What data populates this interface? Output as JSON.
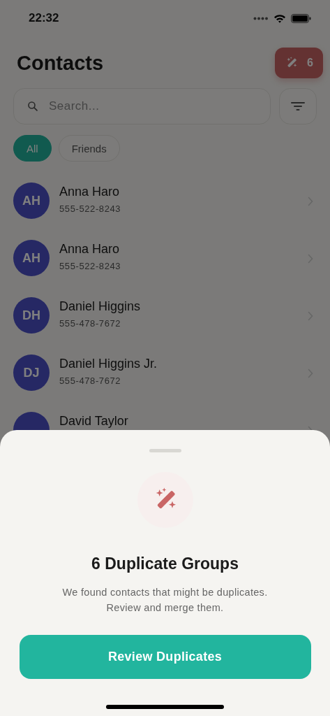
{
  "status_bar": {
    "time": "22:32"
  },
  "header": {
    "title": "Contacts",
    "duplicates_badge": "6"
  },
  "search": {
    "placeholder": "Search..."
  },
  "filters": [
    {
      "label": "All",
      "selected": true
    },
    {
      "label": "Friends",
      "selected": false
    }
  ],
  "contacts": [
    {
      "initials": "AH",
      "name": "Anna Haro",
      "phone": "555-522-8243"
    },
    {
      "initials": "AH",
      "name": "Anna Haro",
      "phone": "555-522-8243"
    },
    {
      "initials": "DH",
      "name": "Daniel Higgins",
      "phone": "555-478-7672"
    },
    {
      "initials": "DJ",
      "name": "Daniel Higgins Jr.",
      "phone": "555-478-7672"
    },
    {
      "name": "David Taylor"
    }
  ],
  "sheet": {
    "title": "6 Duplicate Groups",
    "message": "We found contacts that might be duplicates. Review and merge them.",
    "button": "Review Duplicates"
  }
}
